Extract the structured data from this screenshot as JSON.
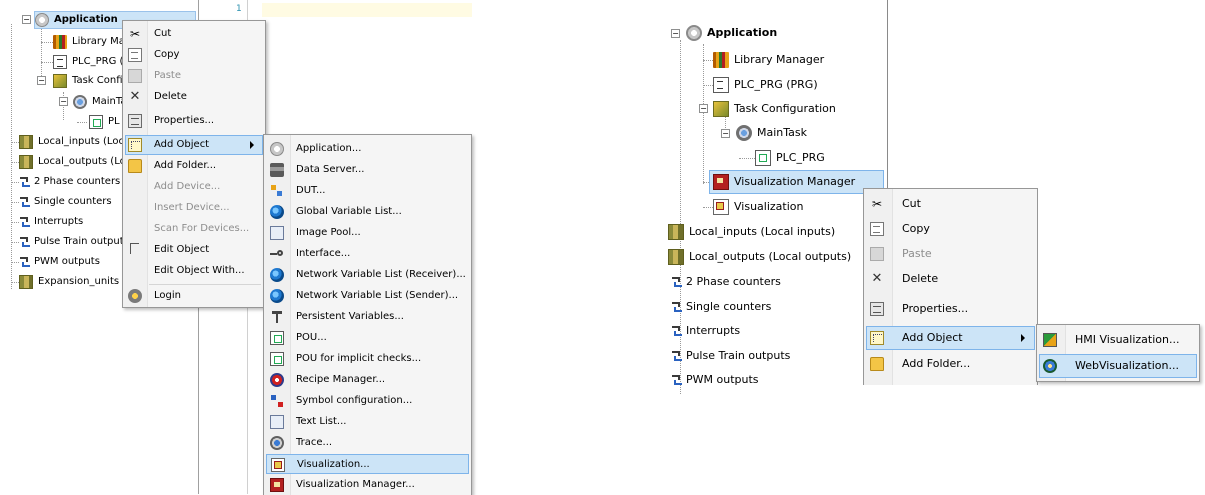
{
  "left": {
    "tree": {
      "application": "Application",
      "library_manager": "Library Mar",
      "plc_prg": "PLC_PRG (I",
      "task_config": "Task Config",
      "main_task": "MainTa",
      "plc_prg_call": "PL",
      "local_inputs": "Local_inputs (Local",
      "local_outputs": "Local_outputs (Loc",
      "phase2": "2 Phase counters",
      "single": "Single counters",
      "interrupts": "Interrupts",
      "pulse": "Pulse Train outputs",
      "pwm": "PWM outputs",
      "expansion": "Expansion_units (E"
    },
    "editor_line": "1",
    "context_menu": {
      "cut": "Cut",
      "copy": "Copy",
      "paste": "Paste",
      "delete": "Delete",
      "properties": "Properties...",
      "add_object": "Add Object",
      "add_folder": "Add Folder...",
      "add_device": "Add Device...",
      "insert_device": "Insert Device...",
      "scan_devices": "Scan For Devices...",
      "edit_object": "Edit Object",
      "edit_object_with": "Edit Object With...",
      "login": "Login"
    },
    "submenu": {
      "items": [
        {
          "label": "Application...",
          "icon": "gear-icon"
        },
        {
          "label": "Data Server...",
          "icon": "data-server-icon"
        },
        {
          "label": "DUT...",
          "icon": "dut-icon"
        },
        {
          "label": "Global Variable List...",
          "icon": "globe-icon"
        },
        {
          "label": "Image Pool...",
          "icon": "image-pool-icon"
        },
        {
          "label": "Interface...",
          "icon": "interface-icon"
        },
        {
          "label": "Network Variable List (Receiver)...",
          "icon": "globe-icon"
        },
        {
          "label": "Network Variable List (Sender)...",
          "icon": "globe-icon"
        },
        {
          "label": "Persistent Variables...",
          "icon": "persistent-icon"
        },
        {
          "label": "POU...",
          "icon": "pou-icon"
        },
        {
          "label": "POU for implicit checks...",
          "icon": "pou-icon"
        },
        {
          "label": "Recipe Manager...",
          "icon": "recipe-icon"
        },
        {
          "label": "Symbol configuration...",
          "icon": "symbol-icon"
        },
        {
          "label": "Text List...",
          "icon": "text-list-icon"
        },
        {
          "label": "Trace...",
          "icon": "trace-icon"
        },
        {
          "label": "Visualization...",
          "icon": "visualization-icon"
        },
        {
          "label": "Visualization Manager...",
          "icon": "visualization-manager-icon"
        }
      ],
      "highlighted_index": 15
    }
  },
  "right": {
    "tree": {
      "application": "Application",
      "library_manager": "Library Manager",
      "plc_prg": "PLC_PRG (PRG)",
      "task_config": "Task Configuration",
      "main_task": "MainTask",
      "plc_prg_call": "PLC_PRG",
      "vis_manager": "Visualization Manager",
      "visualization": "Visualization",
      "local_inputs": "Local_inputs (Local inputs)",
      "local_outputs": "Local_outputs (Local outputs)",
      "phase2": "2 Phase counters",
      "single": "Single counters",
      "interrupts": "Interrupts",
      "pulse": "Pulse Train outputs",
      "pwm": "PWM outputs"
    },
    "context_menu": {
      "cut": "Cut",
      "copy": "Copy",
      "paste": "Paste",
      "delete": "Delete",
      "properties": "Properties...",
      "add_object": "Add Object",
      "add_folder": "Add Folder..."
    },
    "submenu": {
      "hmi": "HMI Visualization...",
      "web": "WebVisualization..."
    }
  },
  "colors": {
    "selection": "#cce4f7",
    "selection_border": "#7eb4ea",
    "menu_bg": "#f5f5f5",
    "editor_highlight": "#fffbe3"
  }
}
